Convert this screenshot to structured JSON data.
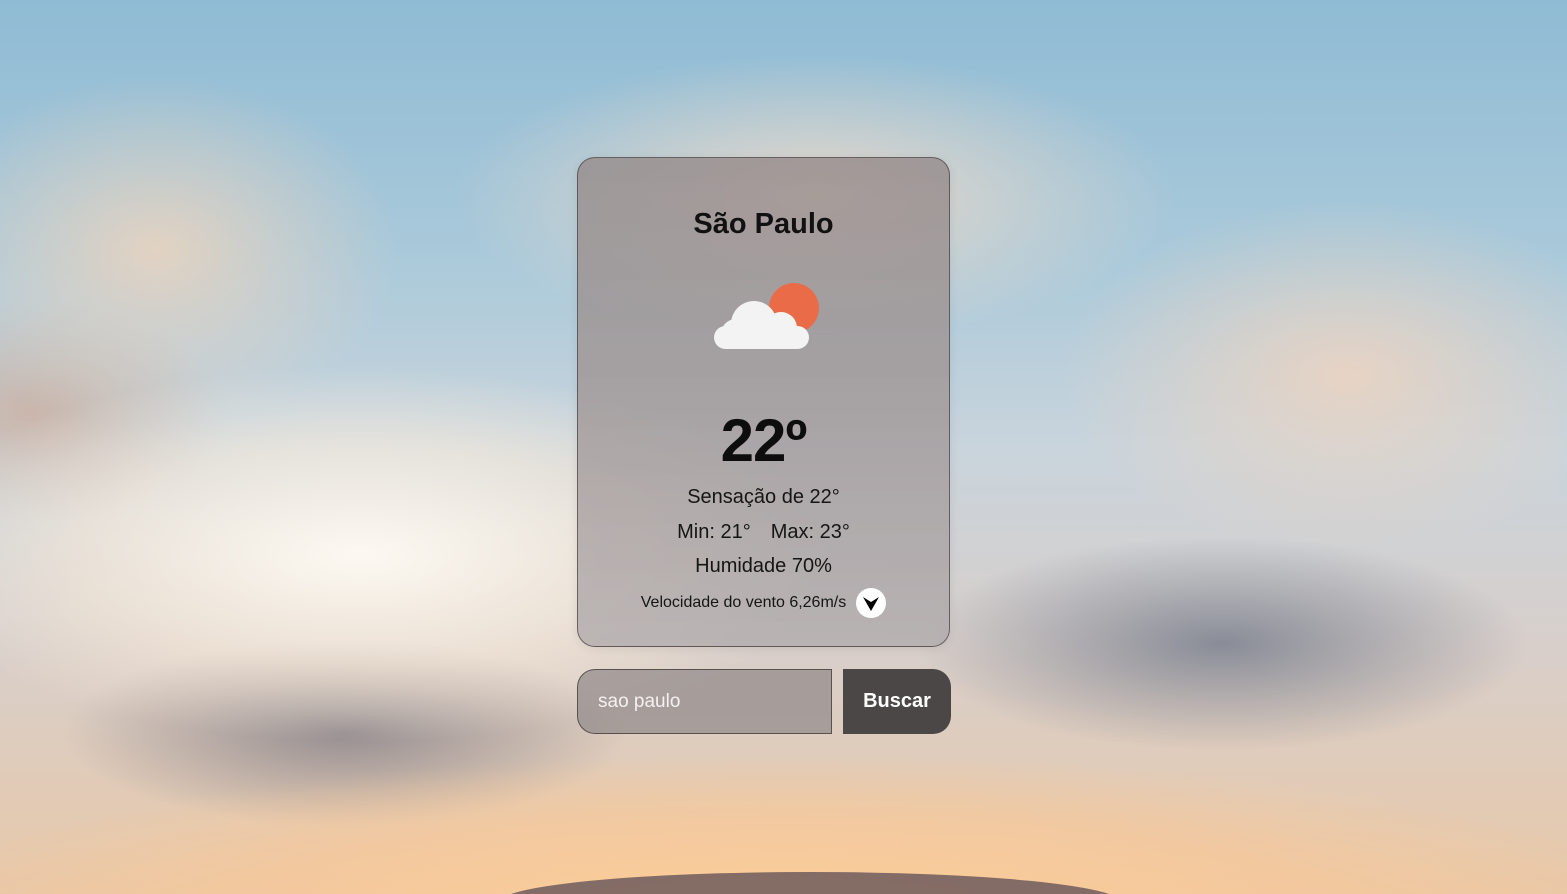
{
  "weather": {
    "city": "São Paulo",
    "icon": "partly-cloudy-icon",
    "temperature": "22º",
    "feels_like": "Sensação de 22°",
    "min": "Min: 21°",
    "max": "Max: 23°",
    "humidity": "Humidade 70%",
    "wind": "Velocidade do vento 6,26m/s",
    "wind_icon": "wind-direction-icon"
  },
  "search": {
    "value": "sao paulo",
    "button_label": "Buscar"
  },
  "colors": {
    "sun": "#ea6b47",
    "cloud": "#f3f3f3",
    "button_bg": "#373436"
  }
}
